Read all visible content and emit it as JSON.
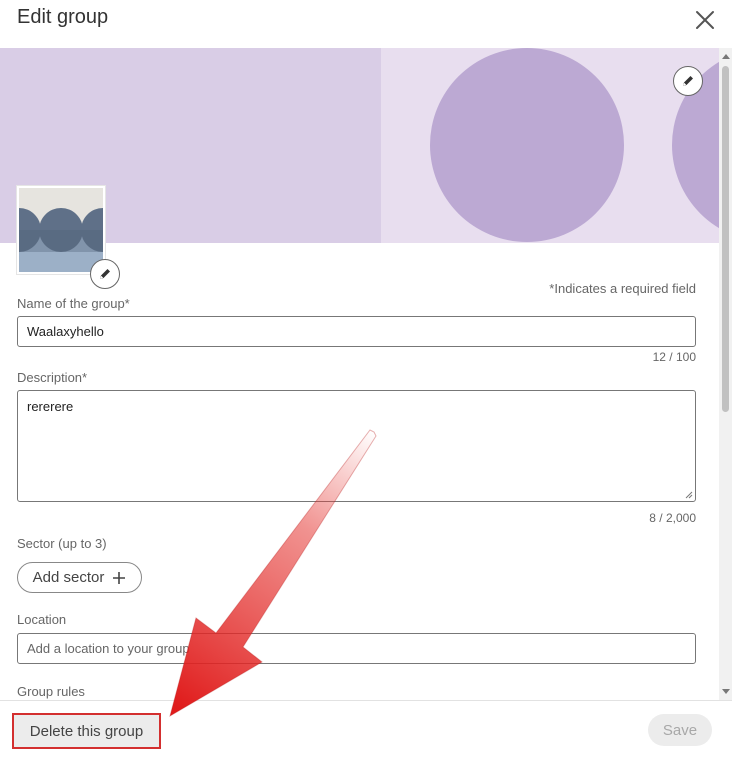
{
  "dialog": {
    "title": "Edit group"
  },
  "form": {
    "required_note": "*Indicates a required field",
    "name": {
      "label": "Name of the group*",
      "value": "Waalaxyhello",
      "counter": "12 / 100"
    },
    "description": {
      "label": "Description*",
      "value": "rererere",
      "counter": "8 / 2,000"
    },
    "sector": {
      "label": "Sector (up to 3)",
      "add_button": "Add sector",
      "add_icon": "plus-icon"
    },
    "location": {
      "label": "Location",
      "placeholder": "Add a location to your group"
    },
    "rules": {
      "label": "Group rules"
    }
  },
  "footer": {
    "delete_label": "Delete this group",
    "save_label": "Save"
  },
  "colors": {
    "banner_bg": "#e8deef",
    "banner_left": "#d9cde6",
    "banner_circle": "#bca9d3",
    "highlight_red": "#d32f2f"
  }
}
